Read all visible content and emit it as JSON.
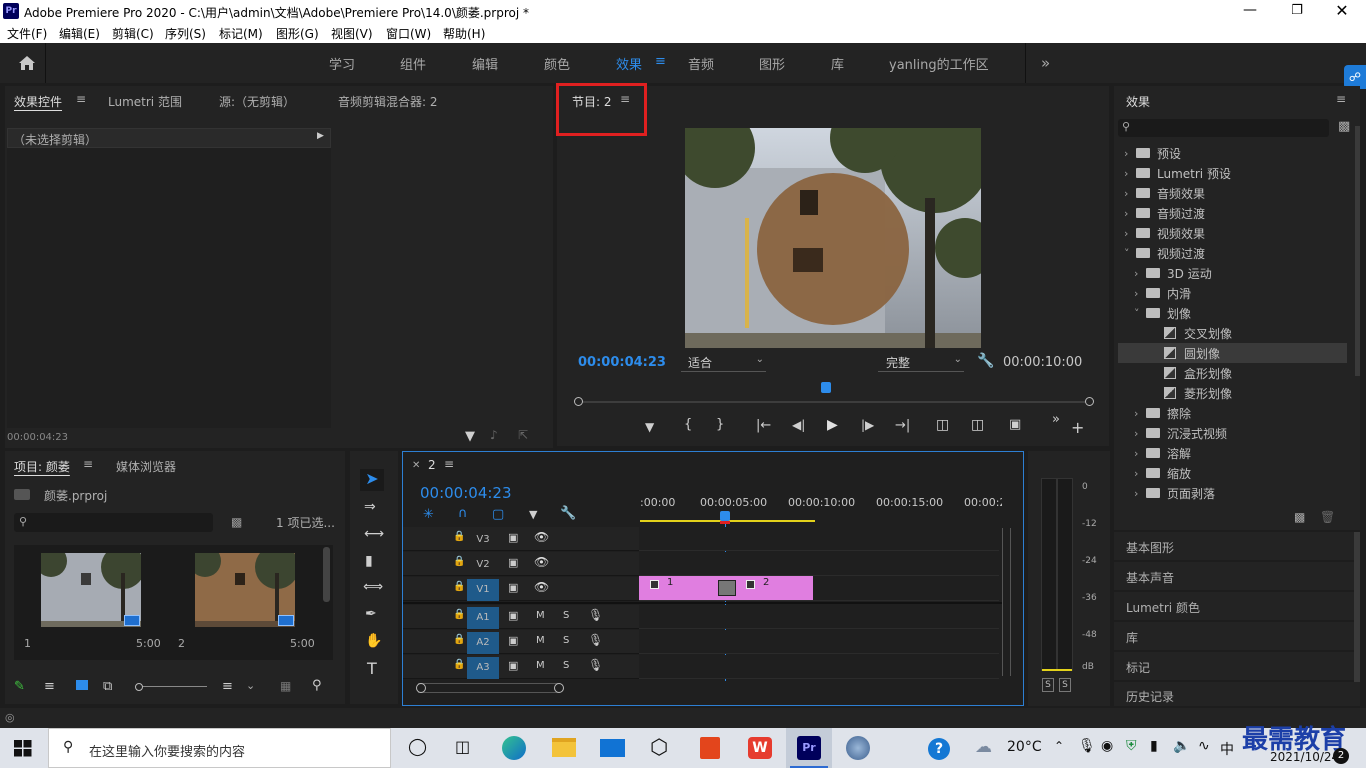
{
  "window": {
    "title": "Adobe Premiere Pro 2020 - C:\\用户\\admin\\文档\\Adobe\\Premiere Pro\\14.0\\颜萎.prproj *",
    "app_icon": "Pr"
  },
  "menu": [
    "文件(F)",
    "编辑(E)",
    "剪辑(C)",
    "序列(S)",
    "标记(M)",
    "图形(G)",
    "视图(V)",
    "窗口(W)",
    "帮助(H)"
  ],
  "workspaces": [
    "学习",
    "组件",
    "编辑",
    "颜色",
    "效果",
    "音频",
    "图形",
    "库",
    "yanling的工作区"
  ],
  "active_workspace": "效果",
  "source_panel": {
    "tabs": [
      "效果控件",
      "Lumetri 范围",
      "源:（无剪辑）",
      "音频剪辑混合器: 2"
    ],
    "no_clip": "（未选择剪辑）",
    "timecode": "00:00:04:23"
  },
  "program": {
    "tab": "节目: 2",
    "timecode": "00:00:04:23",
    "fit": "适合",
    "quality": "完整",
    "duration": "00:00:10:00"
  },
  "project": {
    "tabs": [
      "项目: 颜萎",
      "媒体浏览器"
    ],
    "file": "颜萎.prproj",
    "selected": "1 项已选...",
    "items": [
      {
        "num": "1",
        "dur": "5:00"
      },
      {
        "num": "2",
        "dur": "5:00"
      }
    ]
  },
  "timeline": {
    "seq": "2",
    "timecode": "00:00:04:23",
    "ruler": [
      ":00:00",
      "00:00:05:00",
      "00:00:10:00",
      "00:00:15:00",
      "00:00:2"
    ],
    "tracks": [
      {
        "name": "V3",
        "type": "video"
      },
      {
        "name": "V2",
        "type": "video"
      },
      {
        "name": "V1",
        "type": "video"
      },
      {
        "name": "A1",
        "type": "audio"
      },
      {
        "name": "A2",
        "type": "audio"
      },
      {
        "name": "A3",
        "type": "audio"
      }
    ],
    "clip_labels": [
      "1",
      "2"
    ],
    "audio_btns": [
      "M",
      "S"
    ]
  },
  "meter": {
    "scale": [
      "0",
      "-12",
      "-24",
      "-36",
      "-48",
      "dB"
    ],
    "solo": [
      "S",
      "S"
    ]
  },
  "effects": {
    "title": "效果",
    "tree": [
      {
        "label": "预设",
        "depth": 0,
        "kind": "folder-special",
        "open": false
      },
      {
        "label": "Lumetri 预设",
        "depth": 0,
        "kind": "folder-special",
        "open": false
      },
      {
        "label": "音频效果",
        "depth": 0,
        "kind": "folder",
        "open": false
      },
      {
        "label": "音频过渡",
        "depth": 0,
        "kind": "folder",
        "open": false
      },
      {
        "label": "视频效果",
        "depth": 0,
        "kind": "folder",
        "open": false
      },
      {
        "label": "视频过渡",
        "depth": 0,
        "kind": "folder",
        "open": true
      },
      {
        "label": "3D 运动",
        "depth": 1,
        "kind": "folder",
        "open": false
      },
      {
        "label": "内滑",
        "depth": 1,
        "kind": "folder",
        "open": false
      },
      {
        "label": "划像",
        "depth": 1,
        "kind": "folder",
        "open": true
      },
      {
        "label": "交叉划像",
        "depth": 2,
        "kind": "fx"
      },
      {
        "label": "圆划像",
        "depth": 2,
        "kind": "fx",
        "selected": true
      },
      {
        "label": "盒形划像",
        "depth": 2,
        "kind": "fx"
      },
      {
        "label": "菱形划像",
        "depth": 2,
        "kind": "fx"
      },
      {
        "label": "擦除",
        "depth": 1,
        "kind": "folder",
        "open": false
      },
      {
        "label": "沉浸式视频",
        "depth": 1,
        "kind": "folder",
        "open": false
      },
      {
        "label": "溶解",
        "depth": 1,
        "kind": "folder",
        "open": false
      },
      {
        "label": "缩放",
        "depth": 1,
        "kind": "folder",
        "open": false
      },
      {
        "label": "页面剥落",
        "depth": 1,
        "kind": "folder",
        "open": false
      }
    ],
    "sections": [
      "基本图形",
      "基本声音",
      "Lumetri 颜色",
      "库",
      "标记",
      "历史记录"
    ]
  },
  "taskbar": {
    "search": "在这里输入你要搜索的内容",
    "temp": "20°C",
    "ime": "中",
    "date": "2021/10/24",
    "watermark": "最需教育",
    "badge": "2"
  },
  "colors": {
    "accent": "#2d8ceb",
    "clip": "#e07ee0",
    "highlight": "#e02020",
    "track_blue": "#1f5a8a"
  }
}
